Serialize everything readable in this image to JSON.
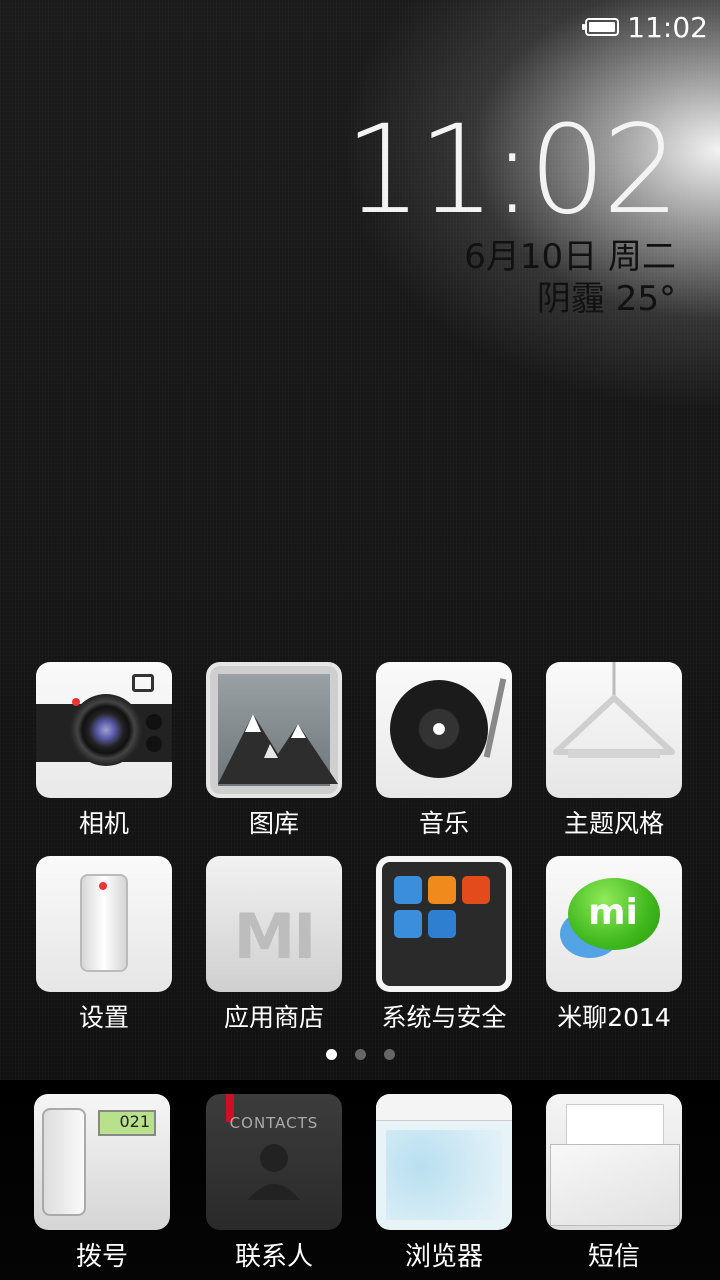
{
  "status_bar": {
    "time": "11:02"
  },
  "clock_widget": {
    "time": "11:02",
    "date": "6月10日 周二",
    "weather": "阴霾  25°"
  },
  "home_icons": [
    {
      "label": "相机"
    },
    {
      "label": "图库"
    },
    {
      "label": "音乐"
    },
    {
      "label": "主题风格"
    },
    {
      "label": "设置"
    },
    {
      "label": "应用商店",
      "icon_text": "MI"
    },
    {
      "label": "系统与安全"
    },
    {
      "label": "米聊2014",
      "icon_text": "mi"
    }
  ],
  "page_indicator": {
    "total": 3,
    "active": 1
  },
  "dock": [
    {
      "label": "拨号",
      "icon_text": "021"
    },
    {
      "label": "联系人",
      "icon_text": "CONTACTS"
    },
    {
      "label": "浏览器"
    },
    {
      "label": "短信"
    }
  ]
}
